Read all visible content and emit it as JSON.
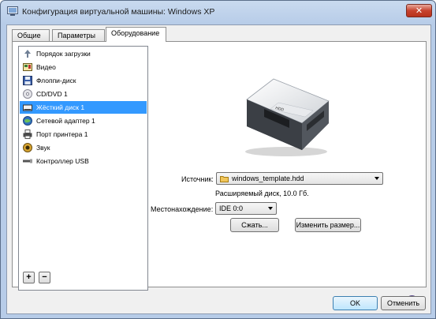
{
  "window": {
    "title": "Конфигурация виртуальной машины: Windows XP"
  },
  "tabs": [
    {
      "label": "Общие",
      "active": false
    },
    {
      "label": "Параметры",
      "active": false
    },
    {
      "label": "Оборудование",
      "active": true
    }
  ],
  "devices": [
    {
      "label": "Порядок загрузки",
      "icon": "boot-order-icon"
    },
    {
      "label": "Видео",
      "icon": "video-icon"
    },
    {
      "label": "Флоппи-диск",
      "icon": "floppy-icon"
    },
    {
      "label": "CD/DVD 1",
      "icon": "cd-dvd-icon"
    },
    {
      "label": "Жёсткий диск 1",
      "icon": "hard-disk-icon",
      "selected": true
    },
    {
      "label": "Сетевой адаптер 1",
      "icon": "network-adapter-icon"
    },
    {
      "label": "Порт принтера 1",
      "icon": "printer-icon"
    },
    {
      "label": "Звук",
      "icon": "sound-icon"
    },
    {
      "label": "Контроллер USB",
      "icon": "usb-icon"
    }
  ],
  "device_list_buttons": {
    "add": "+",
    "remove": "−"
  },
  "disk": {
    "source_label": "Источник:",
    "source_value": "windows_template.hdd",
    "info": "Расширяемый диск, 10.0 Гб.",
    "location_label": "Местонахождение:",
    "location_value": "IDE 0:0",
    "compact_button": "Сжать...",
    "resize_button": "Изменить размер...",
    "image_label": "HDD"
  },
  "footer": {
    "ok": "OK",
    "cancel": "Отменить",
    "help": "?"
  },
  "colors": {
    "selection": "#3399ff",
    "titlebar": "#b7cce8",
    "close": "#c7432e"
  }
}
